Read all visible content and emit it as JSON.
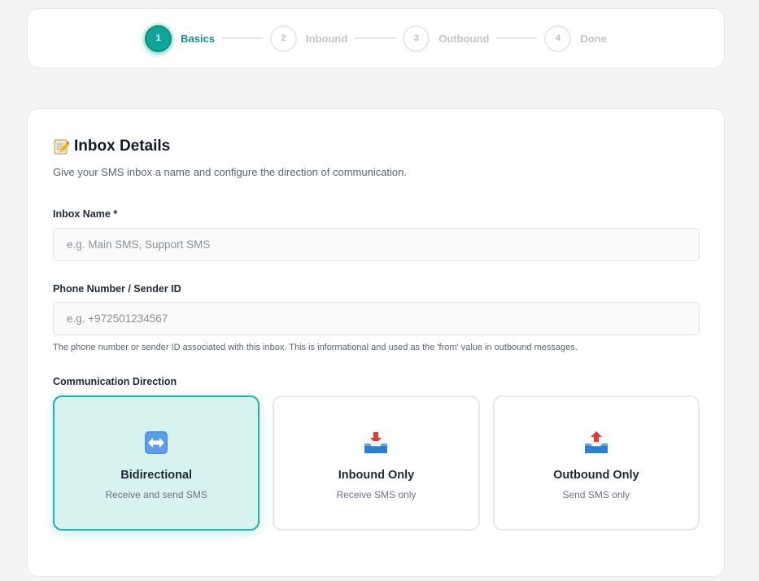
{
  "stepper": {
    "steps": [
      {
        "number": "1",
        "label": "Basics",
        "active": true
      },
      {
        "number": "2",
        "label": "Inbound",
        "active": false
      },
      {
        "number": "3",
        "label": "Outbound",
        "active": false
      },
      {
        "number": "4",
        "label": "Done",
        "active": false
      }
    ]
  },
  "section": {
    "title": "Inbox Details",
    "title_icon": "memo-icon",
    "description": "Give your SMS inbox a name and configure the direction of communication."
  },
  "fields": {
    "inbox_name": {
      "label": "Inbox Name *",
      "value": "",
      "placeholder": "e.g. Main SMS, Support SMS"
    },
    "phone": {
      "label": "Phone Number / Sender ID",
      "value": "",
      "placeholder": "e.g. +972501234567"
    },
    "phone_help": "The phone number or sender ID associated with this inbox. This is informational and used as the 'from' value in outbound messages."
  },
  "direction": {
    "label": "Communication Direction",
    "selected": "bidirectional",
    "options": [
      {
        "id": "bidirectional",
        "icon": "left-right-arrow-icon",
        "title": "Bidirectional",
        "subtitle": "Receive and send SMS"
      },
      {
        "id": "inbound",
        "icon": "inbox-tray-icon",
        "title": "Inbound Only",
        "subtitle": "Receive SMS only"
      },
      {
        "id": "outbound",
        "icon": "outbox-tray-icon",
        "title": "Outbound Only",
        "subtitle": "Send SMS only"
      }
    ]
  },
  "colors": {
    "accent": "#0fa699",
    "accent_text": "#0d9488",
    "selected_bg": "#d8f3ef",
    "selected_border": "#14b8a6"
  }
}
